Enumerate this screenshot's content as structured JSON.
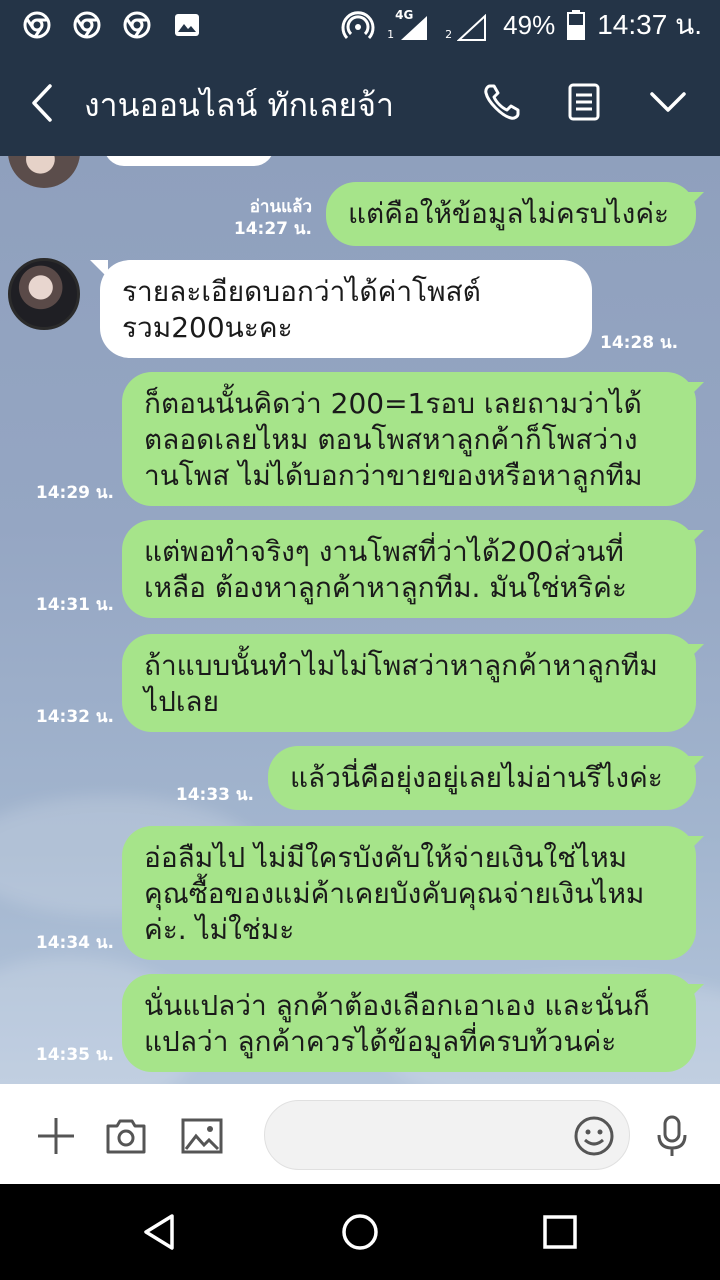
{
  "status_bar": {
    "network": "4G",
    "sim1": "1",
    "sim2": "2",
    "battery": "49%",
    "time": "14:37 น."
  },
  "header": {
    "title": "งานออนไลน์ ทักเลยจ้า",
    "icons": [
      "back-arrow-icon",
      "phone-icon",
      "notes-icon",
      "chevron-down-icon"
    ]
  },
  "messages": [
    {
      "dir": "out",
      "text": "แต่คือให้ข้อมูลไม่ครบไงค่ะ",
      "read": "อ่านแล้ว",
      "time": "14:27 น."
    },
    {
      "dir": "in",
      "lines": [
        "รายละเอียดบอกว่าได้ค่าโพสต์",
        "รวม200นะคะ"
      ],
      "time": "14:28 น."
    },
    {
      "dir": "out",
      "lines": [
        "ก็ตอนนั้นคิดว่า 200=1รอบ เลยถามว่าได้",
        "ตลอดเลยไหม ตอนโพสหาลูกค้าก็โพสว่าง",
        "านโพส ไม่ได้บอกว่าขายของหรือหาลูกทีม"
      ],
      "time": "14:29 น."
    },
    {
      "dir": "out",
      "lines": [
        "แต่พอทำจริงๆ งานโพสที่ว่าได้200ส่วนที่",
        "เหลือ ต้องหาลูกค้าหาลูกทีม.  มันใช่หริค่ะ"
      ],
      "time": "14:31 น."
    },
    {
      "dir": "out",
      "lines": [
        "ถ้าแบบนั้นทำไมไม่โพสว่าหาลูกค้าหาลูกทีม",
        "ไปเลย"
      ],
      "time": "14:32 น."
    },
    {
      "dir": "out",
      "text": "แล้วนี่คือยุ่งอยู่เลยไม่อ่านรึไงค่ะ",
      "time": "14:33 น."
    },
    {
      "dir": "out",
      "lines": [
        "อ่อลืมไป ไม่มีใครบังคับให้จ่ายเงินใช่ไหม",
        "คุณซื้อของแม่ค้าเคยบังคับคุณจ่ายเงินไหม",
        "ค่ะ. ไม่ใช่มะ"
      ],
      "time": "14:34 น."
    },
    {
      "dir": "out",
      "lines": [
        "นั่นแปลว่า ลูกค้าต้องเลือกเอาเอง และนั่นก็",
        "แปลว่า ลูกค้าควรได้ข้อมูลที่ครบท้วนค่ะ"
      ],
      "time": "14:35 น."
    }
  ],
  "input_bar": {
    "placeholder": "",
    "icons": [
      "plus-icon",
      "camera-icon",
      "image-icon",
      "emoji-icon",
      "microphone-icon"
    ]
  },
  "nav_bar": {
    "icons": [
      "back-triangle-icon",
      "home-circle-icon",
      "recents-square-icon"
    ]
  },
  "colors": {
    "header_bg": "#243447",
    "bubble_out": "#a6e48a",
    "bubble_in": "#ffffff",
    "chat_bg": "#95a6c3"
  }
}
